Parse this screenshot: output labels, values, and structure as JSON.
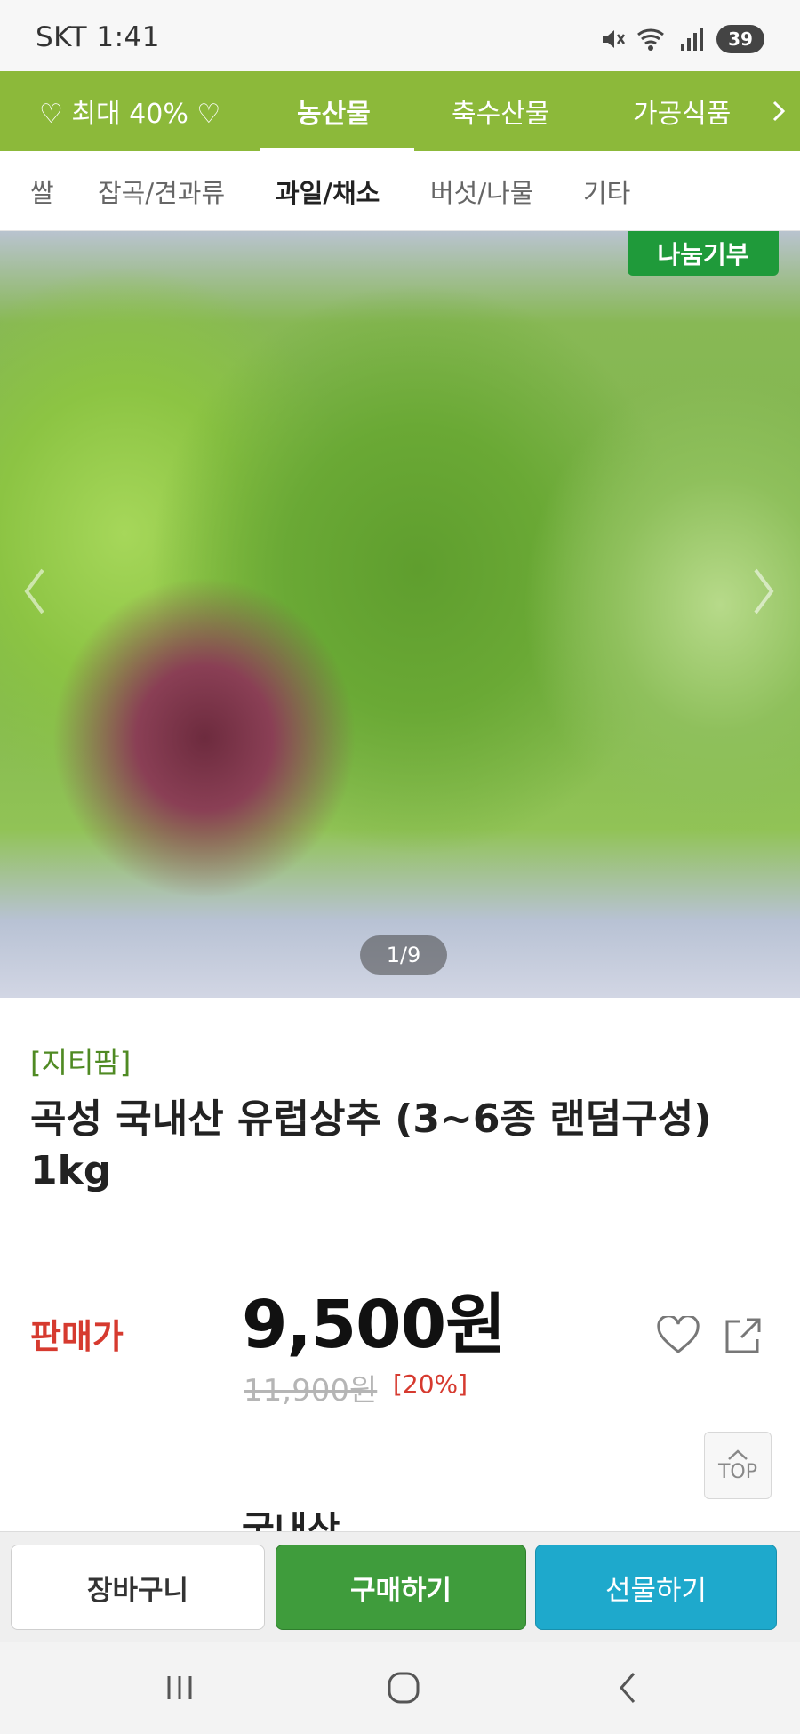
{
  "status_bar": {
    "carrier_time": "SKT 1:41",
    "battery": "39",
    "icons": [
      "mute-icon",
      "wifi-icon",
      "signal-icon"
    ]
  },
  "category_bar": {
    "items": [
      "♡ 최대 40% ♡",
      "농산물",
      "축수산물",
      "가공식품"
    ],
    "active_index": 1,
    "color": "#8cb93a"
  },
  "sub_tabs": {
    "items": [
      "쌀",
      "잡곡/견과류",
      "과일/채소",
      "버섯/나물",
      "기타"
    ],
    "active_index": 2
  },
  "product_image": {
    "badge": "나눔기부",
    "pager": "1/9"
  },
  "product": {
    "brand": "[지티팜]",
    "title": "곡성 국내산 유럽상추 (3~6종 랜덤구성) 1kg",
    "price_label": "판매가",
    "price": "9,500원",
    "original_price": "11,900원",
    "discount": "[20%]"
  },
  "top_button": "TOP",
  "next_row_value": "국내산",
  "actions": {
    "cart": "장바구니",
    "buy": "구매하기",
    "gift": "선물하기"
  },
  "colors": {
    "accent_green": "#8cb93a",
    "buy_green": "#3f9c3c",
    "gift_blue": "#1ea9cc",
    "price_red": "#d63a2f"
  }
}
